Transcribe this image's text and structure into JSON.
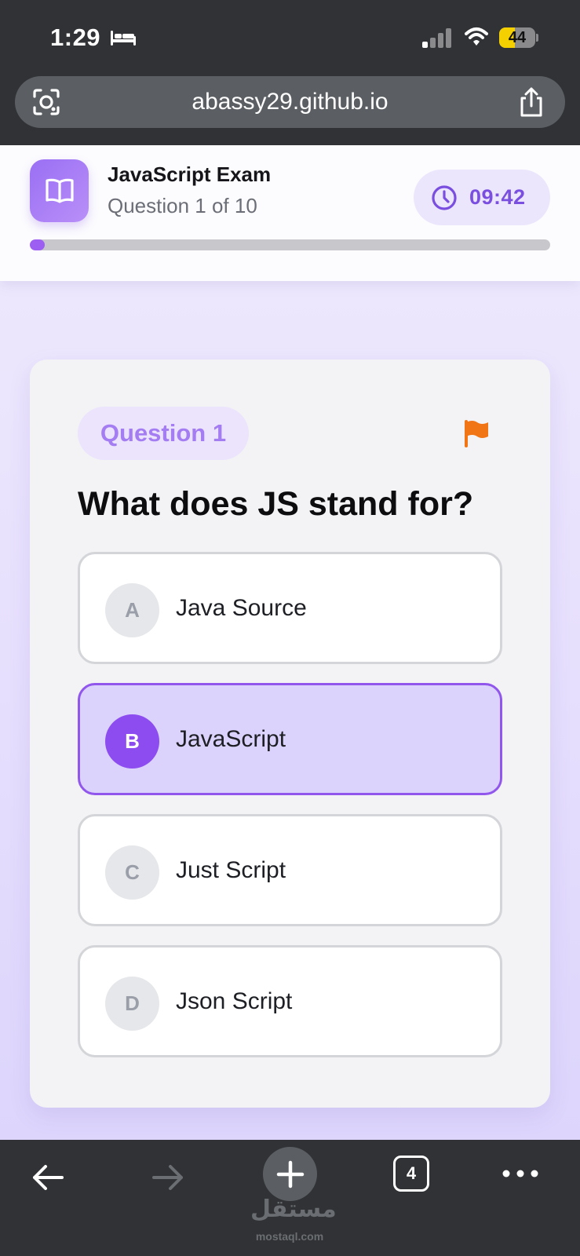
{
  "status_bar": {
    "time": "1:29",
    "battery_level": "44",
    "battery_fraction": 0.44,
    "icons": [
      "bed-icon",
      "signal-icon",
      "wifi-icon",
      "battery-icon"
    ]
  },
  "browser": {
    "url": "abassy29.github.io",
    "icons": [
      "lens-icon",
      "share-icon"
    ]
  },
  "exam": {
    "title": "JavaScript Exam",
    "progress_text": "Question 1 of 10",
    "timer": "09:42",
    "progress_fraction": 0.028,
    "icons": [
      "book-icon",
      "clock-icon"
    ]
  },
  "question": {
    "badge": "Question 1",
    "text": "What does JS stand for?",
    "flag_color": "#f27515",
    "options": [
      {
        "letter": "A",
        "label": "Java Source",
        "selected": false
      },
      {
        "letter": "B",
        "label": "JavaScript",
        "selected": true
      },
      {
        "letter": "C",
        "label": "Just Script",
        "selected": false
      },
      {
        "letter": "D",
        "label": "Json Script",
        "selected": false
      }
    ]
  },
  "toolbar": {
    "tab_count": "4",
    "icons": [
      "back-icon",
      "forward-icon",
      "plus-icon",
      "tabs-icon",
      "more-icon"
    ]
  },
  "watermark": {
    "logo_text": "مستقل",
    "site": "mostaql.com"
  },
  "colors": {
    "accent": "#8d4cf0",
    "timer_text": "#7a4fe0",
    "selected_bg": "#dcd3fd",
    "chrome_bg": "#303235"
  }
}
